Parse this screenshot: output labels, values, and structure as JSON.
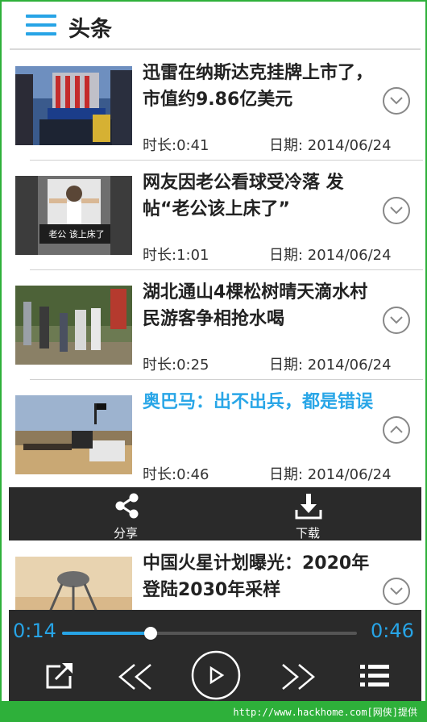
{
  "header": {
    "title": "头条"
  },
  "news": [
    {
      "title": "迅雷在纳斯达克挂牌上市了，市值约9.86亿美元",
      "duration": "时长:0:41",
      "date": "日期: 2014/06/24",
      "expanded": false
    },
    {
      "title": "网友因老公看球受冷落 发帖“老公该上床了”",
      "duration": "时长:1:01",
      "date": "日期: 2014/06/24",
      "expanded": false,
      "thumb_caption": "老公 该上床了"
    },
    {
      "title": "湖北通山4棵松树晴天滴水村民游客争相抢水喝",
      "duration": "时长:0:25",
      "date": "日期: 2014/06/24",
      "expanded": false
    },
    {
      "title": "奥巴马：出不出兵，都是错误",
      "duration": "时长:0:46",
      "date": "日期: 2014/06/24",
      "expanded": true
    },
    {
      "title": "中国火星计划曝光：2020年登陆2030年采样",
      "expanded": false
    }
  ],
  "actions": {
    "share": "分享",
    "download": "下载"
  },
  "player": {
    "current": "0:14",
    "total": "0:46",
    "progress": 0.3
  },
  "footer": {
    "watermark": "http://www.hackhome.com[网侠]提供"
  },
  "colors": {
    "accent": "#27a4e6",
    "bar": "#2a2a2a",
    "border": "#2eb03a"
  }
}
